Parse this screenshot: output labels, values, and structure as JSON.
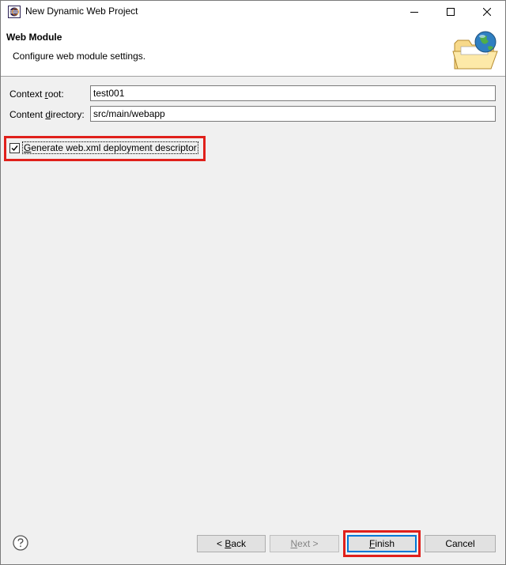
{
  "window": {
    "title": "New Dynamic Web Project",
    "icons": {
      "app": "eclipse-icon",
      "minimize": "minimize-icon",
      "maximize": "maximize-icon",
      "close": "close-icon"
    }
  },
  "banner": {
    "title": "Web Module",
    "description": "Configure web module settings.",
    "image_icon": "web-folder-globe-icon"
  },
  "form": {
    "context_root": {
      "label_before": "Context ",
      "label_mnemonic": "r",
      "label_after": "oot:",
      "value": "test001"
    },
    "content_directory": {
      "label_before": "Content ",
      "label_mnemonic": "d",
      "label_after": "irectory:",
      "value": "src/main/webapp"
    },
    "generate_descriptor": {
      "label_mnemonic": "G",
      "label_rest": "enerate web.xml deployment descriptor",
      "checked": true
    }
  },
  "footer": {
    "help_icon": "help-icon",
    "back": {
      "prefix": "< ",
      "mnemonic": "B",
      "rest": "ack"
    },
    "next": {
      "mnemonic": "N",
      "rest": "ext >"
    },
    "finish": {
      "mnemonic": "F",
      "rest": "inish"
    },
    "cancel": {
      "label": "Cancel"
    }
  },
  "colors": {
    "highlight": "#e0201b",
    "default_button_border": "#0078d7"
  }
}
